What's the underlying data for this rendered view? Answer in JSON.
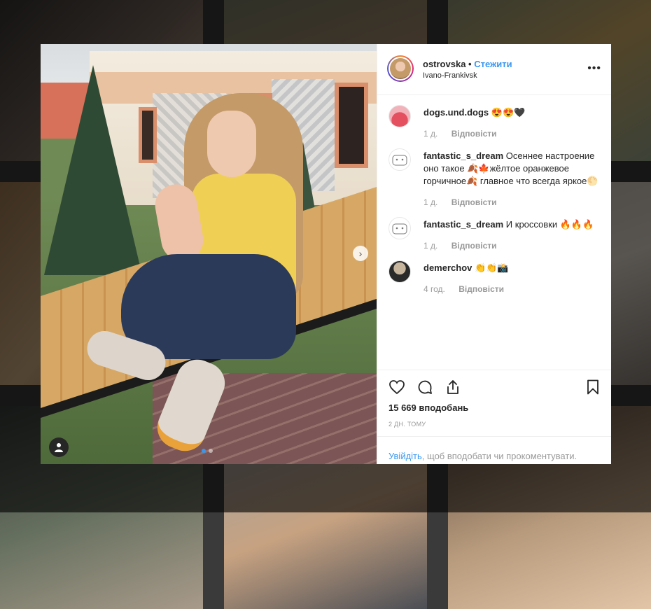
{
  "post": {
    "username": "ostrovska",
    "separator": "•",
    "follow_label": "Стежити",
    "location": "Ivano-Frankivsk",
    "more_label": "•••"
  },
  "comments": [
    {
      "username": "dogs.und.dogs",
      "text": "😍😍🖤",
      "time": "1 д.",
      "reply_label": "Відповісти"
    },
    {
      "username": "fantastic_s_dream",
      "text": "Осеннее настроение оно такое 🍂🍁жёлтое оранжевое горчичное🍂 главное что всегда яркое🌕",
      "time": "1 д.",
      "reply_label": "Відповісти"
    },
    {
      "username": "fantastic_s_dream",
      "text": "И кроссовки 🔥🔥🔥",
      "time": "1 д.",
      "reply_label": "Відповісти"
    },
    {
      "username": "demerchov",
      "text": "👏👏📸",
      "time": "4 год.",
      "reply_label": "Відповісти"
    }
  ],
  "actions": {
    "likes": "15 669 вподобань",
    "posted": "2 ДН. ТОМУ"
  },
  "login_prompt": {
    "link": "Увійдіть",
    "rest": ", щоб вподобати чи прокоментувати."
  },
  "carousel": {
    "total": 2,
    "current": 1,
    "next_label": "›"
  },
  "colors": {
    "accent": "#3897f0",
    "muted": "#999999",
    "text": "#262626"
  },
  "icons": [
    "heart-icon",
    "comment-icon",
    "share-icon",
    "bookmark-icon",
    "more-icon",
    "next-arrow-icon",
    "user-tag-icon"
  ]
}
